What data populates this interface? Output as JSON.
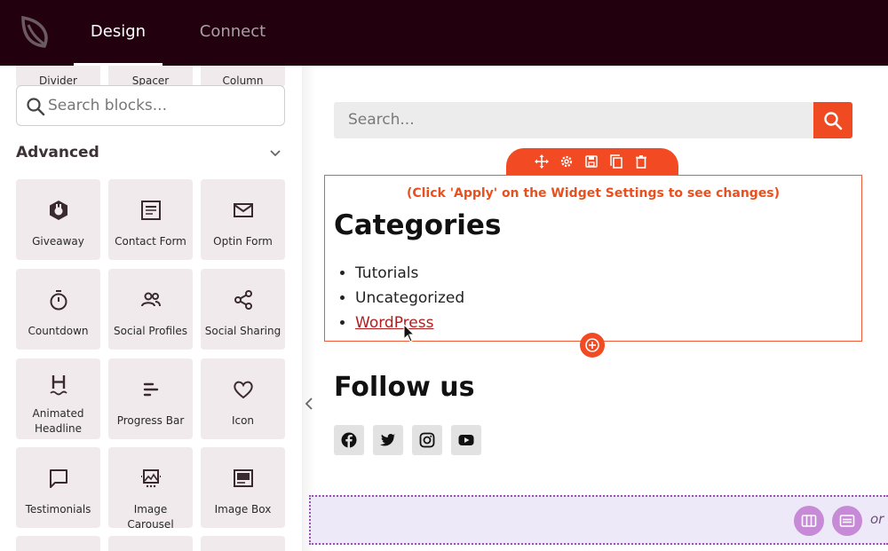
{
  "topbar": {
    "logo_icon": "leaf-logo-icon",
    "tabs": [
      {
        "label": "Design",
        "active": true
      },
      {
        "label": "Connect",
        "active": false
      }
    ]
  },
  "sidebar": {
    "top_row": [
      "Divider",
      "Spacer",
      "Column"
    ],
    "search": {
      "placeholder": "Search blocks...",
      "value": ""
    },
    "section_title": "Advanced",
    "blocks": [
      {
        "label": "Giveaway",
        "icon": "giveaway-icon"
      },
      {
        "label": "Contact Form",
        "icon": "contact-form-icon"
      },
      {
        "label": "Optin Form",
        "icon": "envelope-icon"
      },
      {
        "label": "Countdown",
        "icon": "stopwatch-icon"
      },
      {
        "label": "Social Profiles",
        "icon": "people-icon"
      },
      {
        "label": "Social Sharing",
        "icon": "share-icon"
      },
      {
        "label": "Animated Headline",
        "icon": "heading-icon"
      },
      {
        "label": "Progress Bar",
        "icon": "progress-bars-icon"
      },
      {
        "label": "Icon",
        "icon": "heart-icon"
      },
      {
        "label": "Testimonials",
        "icon": "speech-bubble-icon"
      },
      {
        "label": "Image Carousel",
        "icon": "image-carousel-icon"
      },
      {
        "label": "Image Box",
        "icon": "image-box-icon"
      }
    ]
  },
  "canvas": {
    "search": {
      "placeholder": "Search..."
    },
    "widget": {
      "notice": "(Click 'Apply' on the Widget Settings to see changes)",
      "title": "Categories",
      "items": [
        "Tutorials",
        "Uncategorized",
        "WordPress"
      ]
    },
    "follow": {
      "title": "Follow us",
      "icons": [
        "facebook-icon",
        "twitter-icon",
        "instagram-icon",
        "youtube-icon"
      ]
    },
    "dropzone": {
      "or_label": "or"
    }
  },
  "colors": {
    "topbar": "#22000d",
    "accent": "#f24a22",
    "block_bg": "#f0eaed",
    "dropzone_bg": "#ede9f8",
    "dropzone_button": "#c78ad6"
  }
}
